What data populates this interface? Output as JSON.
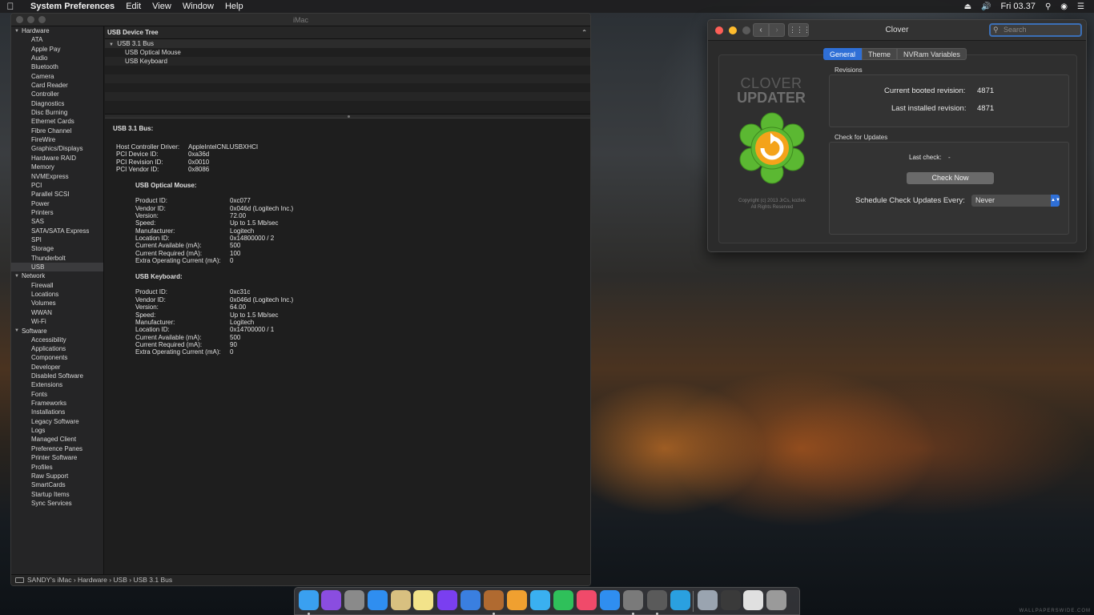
{
  "menubar": {
    "app": "System Preferences",
    "items": [
      "Edit",
      "View",
      "Window",
      "Help"
    ],
    "clock": "Fri 03.37"
  },
  "sysinfo": {
    "title": "iMac",
    "sidebar": [
      {
        "group": "Hardware",
        "items": [
          "ATA",
          "Apple Pay",
          "Audio",
          "Bluetooth",
          "Camera",
          "Card Reader",
          "Controller",
          "Diagnostics",
          "Disc Burning",
          "Ethernet Cards",
          "Fibre Channel",
          "FireWire",
          "Graphics/Displays",
          "Hardware RAID",
          "Memory",
          "NVMExpress",
          "PCI",
          "Parallel SCSI",
          "Power",
          "Printers",
          "SAS",
          "SATA/SATA Express",
          "SPI",
          "Storage",
          "Thunderbolt",
          "USB"
        ]
      },
      {
        "group": "Network",
        "items": [
          "Firewall",
          "Locations",
          "Volumes",
          "WWAN",
          "Wi-Fi"
        ]
      },
      {
        "group": "Software",
        "items": [
          "Accessibility",
          "Applications",
          "Components",
          "Developer",
          "Disabled Software",
          "Extensions",
          "Fonts",
          "Frameworks",
          "Installations",
          "Legacy Software",
          "Logs",
          "Managed Client",
          "Preference Panes",
          "Printer Software",
          "Profiles",
          "Raw Support",
          "SmartCards",
          "Startup Items",
          "Sync Services"
        ]
      }
    ],
    "selected_item": "USB",
    "tree": {
      "header": "USB Device Tree",
      "bus": "USB 3.1 Bus",
      "children": [
        "USB Optical Mouse",
        "USB Keyboard"
      ]
    },
    "detail": {
      "title": "USB 3.1 Bus:",
      "bus_props": [
        [
          "Host Controller Driver:",
          "AppleIntelCNLUSBXHCI"
        ],
        [
          "PCI Device ID:",
          "0xa36d"
        ],
        [
          "PCI Revision ID:",
          "0x0010"
        ],
        [
          "PCI Vendor ID:",
          "0x8086"
        ]
      ],
      "devices": [
        {
          "name": "USB Optical Mouse:",
          "props": [
            [
              "Product ID:",
              "0xc077"
            ],
            [
              "Vendor ID:",
              "0x046d  (Logitech Inc.)"
            ],
            [
              "Version:",
              "72.00"
            ],
            [
              "Speed:",
              "Up to 1.5 Mb/sec"
            ],
            [
              "Manufacturer:",
              "Logitech"
            ],
            [
              "Location ID:",
              "0x14800000 / 2"
            ],
            [
              "Current Available (mA):",
              "500"
            ],
            [
              "Current Required (mA):",
              "100"
            ],
            [
              "Extra Operating Current (mA):",
              "0"
            ]
          ]
        },
        {
          "name": "USB Keyboard:",
          "props": [
            [
              "Product ID:",
              "0xc31c"
            ],
            [
              "Vendor ID:",
              "0x046d  (Logitech Inc.)"
            ],
            [
              "Version:",
              "64.00"
            ],
            [
              "Speed:",
              "Up to 1.5 Mb/sec"
            ],
            [
              "Manufacturer:",
              "Logitech"
            ],
            [
              "Location ID:",
              "0x14700000 / 1"
            ],
            [
              "Current Available (mA):",
              "500"
            ],
            [
              "Current Required (mA):",
              "90"
            ],
            [
              "Extra Operating Current (mA):",
              "0"
            ]
          ]
        }
      ]
    },
    "breadcrumb": "SANDY's iMac › Hardware › USB › USB 3.1 Bus"
  },
  "clover": {
    "title": "Clover",
    "search_placeholder": "Search",
    "tabs": [
      "General",
      "Theme",
      "NVRam Variables"
    ],
    "active_tab": "General",
    "logo_line1": "CLOVER",
    "logo_line2": "UPDATER",
    "copyright_line1": "Copyright (c) 2013 JrCs, kozlek",
    "copyright_line2": "All Rights Reserved",
    "revisions_label": "Revisions",
    "current_booted_label": "Current booted revision:",
    "current_booted_value": "4871",
    "last_installed_label": "Last installed revision:",
    "last_installed_value": "4871",
    "updates_label": "Check for Updates",
    "last_check_label": "Last check:",
    "last_check_value": "-",
    "check_now": "Check Now",
    "schedule_label": "Schedule Check Updates Every:",
    "schedule_value": "Never",
    "accent": "#2f6fd6"
  },
  "dock": {
    "icons": [
      {
        "name": "finder-icon",
        "color": "#3aa0f0",
        "running": true
      },
      {
        "name": "siri-icon",
        "color": "#8a4de0",
        "running": false
      },
      {
        "name": "launchpad-icon",
        "color": "#8a8a8a",
        "running": false
      },
      {
        "name": "safari-icon",
        "color": "#2f8ef0",
        "running": false
      },
      {
        "name": "mail-icon",
        "color": "#d8c080",
        "running": false
      },
      {
        "name": "notes-icon",
        "color": "#f2e38a",
        "running": false
      },
      {
        "name": "imovie-icon",
        "color": "#7a3ff0",
        "running": false
      },
      {
        "name": "xcode-icon",
        "color": "#3a7fe0",
        "running": false
      },
      {
        "name": "instruments-icon",
        "color": "#b06a30",
        "running": true
      },
      {
        "name": "photos-icon",
        "color": "#f0a030",
        "running": false
      },
      {
        "name": "messages-icon",
        "color": "#3ab0f0",
        "running": false
      },
      {
        "name": "facetime-icon",
        "color": "#2fc05a",
        "running": false
      },
      {
        "name": "music-icon",
        "color": "#f04a6a",
        "running": false
      },
      {
        "name": "app-store-icon",
        "color": "#2f8ef0",
        "running": false
      },
      {
        "name": "system-preferences-icon",
        "color": "#7a7a7a",
        "running": true
      },
      {
        "name": "clover-configurator-icon",
        "color": "#5a5a5a",
        "running": true
      },
      {
        "name": "telegram-icon",
        "color": "#2aa0e0",
        "running": false
      },
      {
        "name": "preview-icon",
        "color": "#9aa4b0",
        "running": false
      },
      {
        "name": "terminal-icon",
        "color": "#3a3a3a",
        "running": false
      },
      {
        "name": "document-icon",
        "color": "#e0e0e0",
        "running": false
      },
      {
        "name": "trash-icon",
        "color": "#9a9a9a",
        "running": false
      }
    ]
  },
  "watermark": "WALLPAPERSWIDE.COM"
}
